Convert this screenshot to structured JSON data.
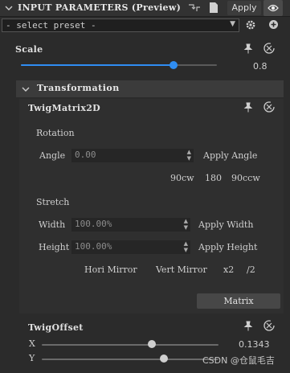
{
  "header": {
    "title": "INPUT PARAMETERS (Preview)",
    "apply_label": "Apply"
  },
  "preset": {
    "label": "- select preset -"
  },
  "scale": {
    "label": "Scale",
    "value": "0.8",
    "level": 0.8
  },
  "transformation": {
    "label": "Transformation"
  },
  "twig_matrix": {
    "label": "TwigMatrix2D",
    "rotation": {
      "section_label": "Rotation",
      "angle_label": "Angle",
      "angle_value": "0.00",
      "apply_angle_label": "Apply Angle",
      "btn_90cw": "90cw",
      "btn_180": "180",
      "btn_90ccw": "90ccw"
    },
    "stretch": {
      "section_label": "Stretch",
      "width_label": "Width",
      "width_value": "100.00%",
      "apply_width_label": "Apply Width",
      "height_label": "Height",
      "height_value": "100.00%",
      "apply_height_label": "Apply Height",
      "hori_mirror_label": "Hori Mirror",
      "vert_mirror_label": "Vert Mirror",
      "x2_label": "x2",
      "div2_label": "/2"
    },
    "matrix_label": "Matrix"
  },
  "twig_offset": {
    "label": "TwigOffset",
    "x_label": "X",
    "x_value": "0.1343",
    "x_level": 0.55,
    "y_label": "Y",
    "y_level": 0.6
  },
  "watermark": "CSDN @仓鼠毛吉",
  "colors": {
    "accent": "#2f8df2",
    "background": "#2b2b2b"
  }
}
